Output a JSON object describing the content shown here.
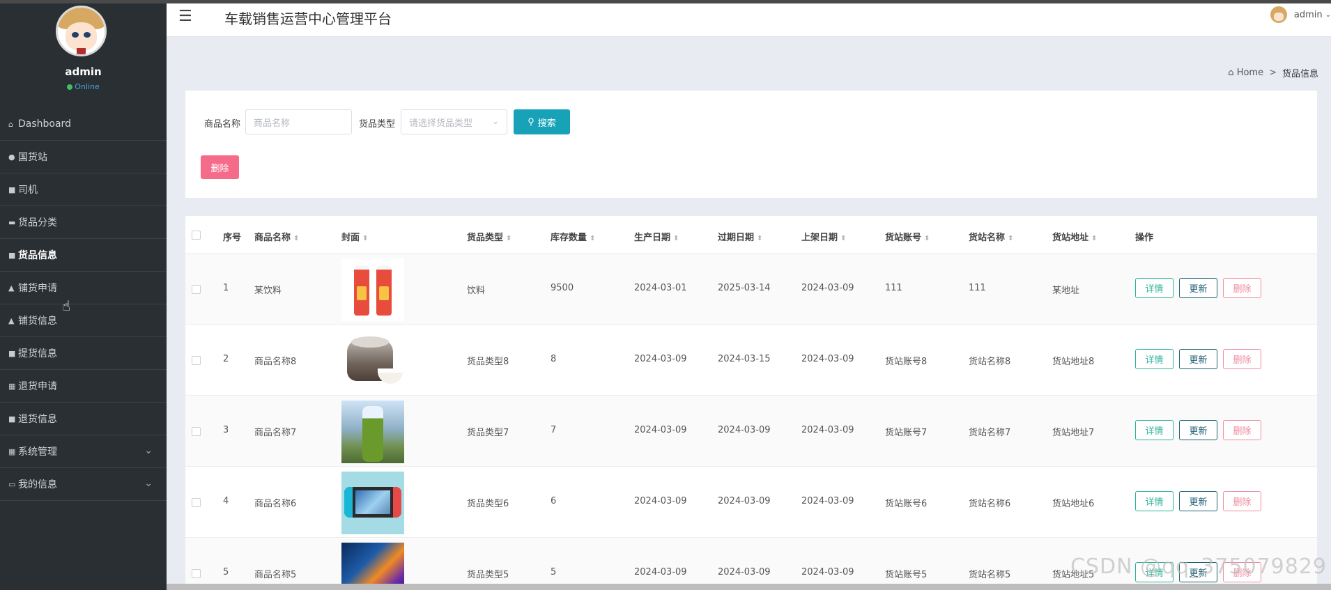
{
  "app": {
    "title": "车载销售运营中心管理平台"
  },
  "sidebar": {
    "username": "admin",
    "status": "Online",
    "items": [
      {
        "label": "Dashboard",
        "icon": "home-icon"
      },
      {
        "label": "国货站",
        "icon": "map-pin-icon"
      },
      {
        "label": "司机",
        "icon": "chat-icon"
      },
      {
        "label": "货品分类",
        "icon": "briefcase-icon"
      },
      {
        "label": "货品信息",
        "icon": "book-icon",
        "active": true
      },
      {
        "label": "铺货申请",
        "icon": "user-icon"
      },
      {
        "label": "铺货信息",
        "icon": "user-icon"
      },
      {
        "label": "提货信息",
        "icon": "clipboard-icon"
      },
      {
        "label": "退货申请",
        "icon": "grid-icon"
      },
      {
        "label": "退货信息",
        "icon": "clipboard-icon"
      },
      {
        "label": "系统管理",
        "icon": "grid-icon",
        "expandable": true
      },
      {
        "label": "我的信息",
        "icon": "card-icon",
        "expandable": true
      }
    ]
  },
  "header": {
    "user": "admin"
  },
  "breadcrumb": {
    "home": "Home",
    "separator": ">",
    "current": "货品信息"
  },
  "search": {
    "name_label": "商品名称",
    "name_placeholder": "商品名称",
    "type_label": "货品类型",
    "type_placeholder": "请选择货品类型",
    "search_button": "搜索",
    "delete_button": "删除"
  },
  "table": {
    "columns": [
      "序号",
      "商品名称",
      "封面",
      "货品类型",
      "库存数量",
      "生产日期",
      "过期日期",
      "上架日期",
      "货站账号",
      "货站名称",
      "货站地址",
      "操作"
    ],
    "actions": {
      "detail": "详情",
      "update": "更新",
      "delete": "删除"
    },
    "rows": [
      {
        "no": "1",
        "name": "某饮料",
        "cover": "drink-bottles",
        "type": "饮料",
        "stock": "9500",
        "produced": "2024-03-01",
        "expires": "2025-03-14",
        "listed": "2024-03-09",
        "account": "111",
        "station": "111",
        "address": "某地址"
      },
      {
        "no": "2",
        "name": "商品名称8",
        "cover": "rice-cooker",
        "type": "货品类型8",
        "stock": "8",
        "produced": "2024-03-09",
        "expires": "2024-03-15",
        "listed": "2024-03-09",
        "account": "货站账号8",
        "station": "货站名称8",
        "address": "货站地址8"
      },
      {
        "no": "3",
        "name": "商品名称7",
        "cover": "water-bottle",
        "type": "货品类型7",
        "stock": "7",
        "produced": "2024-03-09",
        "expires": "2024-03-09",
        "listed": "2024-03-09",
        "account": "货站账号7",
        "station": "货站名称7",
        "address": "货站地址7"
      },
      {
        "no": "4",
        "name": "商品名称6",
        "cover": "game-console",
        "type": "货品类型6",
        "stock": "6",
        "produced": "2024-03-09",
        "expires": "2024-03-09",
        "listed": "2024-03-09",
        "account": "货站账号6",
        "station": "货站名称6",
        "address": "货站地址6"
      },
      {
        "no": "5",
        "name": "商品名称5",
        "cover": "television",
        "type": "货品类型5",
        "stock": "5",
        "produced": "2024-03-09",
        "expires": "2024-03-09",
        "listed": "2024-03-09",
        "account": "货站账号5",
        "station": "货站名称5",
        "address": "货站地址5"
      }
    ]
  },
  "watermark": "CSDN @qq_375079829"
}
